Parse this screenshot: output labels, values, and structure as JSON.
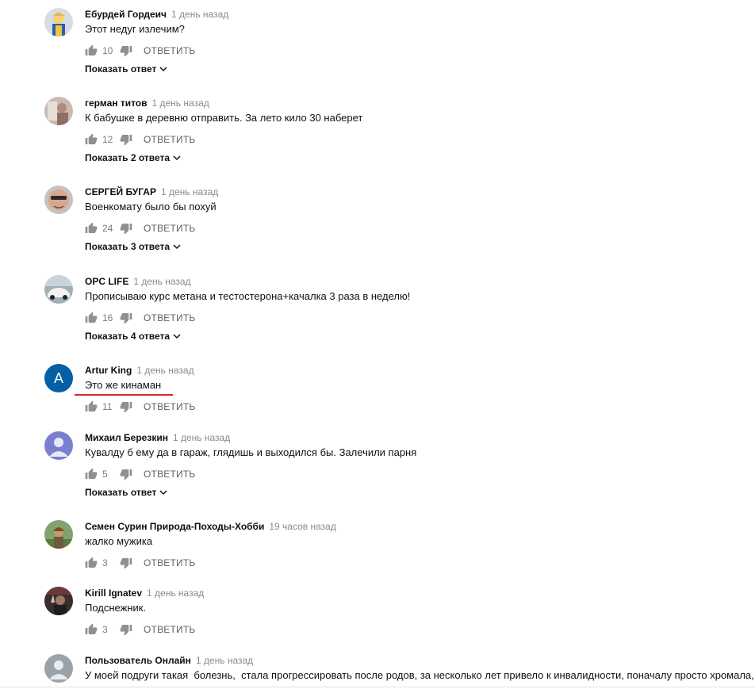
{
  "comments": [
    {
      "author": "Ебурдей Гордеич",
      "time": "1 день назад",
      "text": "Этот недуг излечим?",
      "likes": "10",
      "reply": "ОТВЕТИТЬ",
      "show_replies": "Показать ответ",
      "avatar": "vault-boy-avatar"
    },
    {
      "author": "герман титов",
      "time": "1 день назад",
      "text": "К бабушке в деревню отправить. За лето кило 30 наберет",
      "likes": "12",
      "reply": "ОТВЕТИТЬ",
      "show_replies": "Показать 2 ответа",
      "avatar": "photo-avatar"
    },
    {
      "author": "СЕРГЕЙ БУГАР",
      "time": "1 день назад",
      "text": "Военкомату было бы похуй",
      "likes": "24",
      "reply": "ОТВЕТИТЬ",
      "show_replies": "Показать 3 ответа",
      "avatar": "face-sunglasses-avatar"
    },
    {
      "author": "OPC LIFE",
      "time": "1 день назад",
      "text": "Прописываю курс метана и тестостерона+качалка 3 раза в неделю!",
      "likes": "16",
      "reply": "ОТВЕТИТЬ",
      "show_replies": "Показать 4 ответа",
      "avatar": "car-avatar"
    },
    {
      "author": "Artur King",
      "time": "1 день назад",
      "text": "Это же кинаман",
      "likes": "11",
      "reply": "ОТВЕТИТЬ",
      "avatar": "letter-avatar",
      "avatar_letter": "A"
    },
    {
      "author": "Михаил Березкин",
      "time": "1 день назад",
      "text": "Кувалду б ему да в гараж, глядишь и выходился бы. Залечили парня",
      "likes": "5",
      "reply": "ОТВЕТИТЬ",
      "show_replies": "Показать ответ",
      "avatar": "default-user-avatar"
    },
    {
      "author": "Семен Сурин Природа-Походы-Хобби",
      "time": "19 часов назад",
      "text": "жалко мужика",
      "likes": "3",
      "reply": "ОТВЕТИТЬ",
      "avatar": "outdoor-photo-avatar"
    },
    {
      "author": "Kirill Ignatev",
      "time": "1 день назад",
      "text": "Подснежник.",
      "likes": "3",
      "reply": "ОТВЕТИТЬ",
      "avatar": "dark-photo-avatar"
    },
    {
      "author": "Пользователь Онлайн",
      "time": "1 день назад",
      "text": "У моей подруги такая  болезнь,  стала прогрессировать после родов, за несколько лет привело к инвалидности, поначалу просто хромала, а",
      "avatar": "default-user-avatar"
    }
  ],
  "colors": {
    "accent_underline": "#d0262c",
    "letter_avatar_bg": "#065fa4",
    "default_avatar_bg": "#7a7fcf"
  }
}
